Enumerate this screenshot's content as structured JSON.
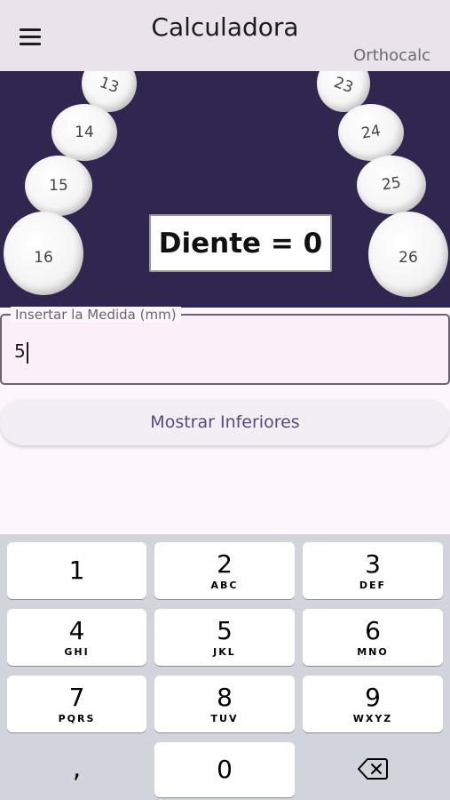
{
  "appbar": {
    "title": "Calculadora",
    "subtitle": "Orthocalc"
  },
  "teeth": [
    {
      "label": "13"
    },
    {
      "label": "14"
    },
    {
      "label": "15"
    },
    {
      "label": "16"
    },
    {
      "label": "23"
    },
    {
      "label": "24"
    },
    {
      "label": "25"
    },
    {
      "label": "26"
    }
  ],
  "display": {
    "text": "Diente = 0"
  },
  "measure_field": {
    "label": "Insertar la Medida (mm)",
    "value": "5"
  },
  "action_button": {
    "label": "Mostrar Inferiores"
  },
  "keypad": {
    "keys": [
      {
        "num": "1",
        "letters": ""
      },
      {
        "num": "2",
        "letters": "ABC"
      },
      {
        "num": "3",
        "letters": "DEF"
      },
      {
        "num": "4",
        "letters": "GHI"
      },
      {
        "num": "5",
        "letters": "JKL"
      },
      {
        "num": "6",
        "letters": "MNO"
      },
      {
        "num": "7",
        "letters": "PQRS"
      },
      {
        "num": "8",
        "letters": "TUV"
      },
      {
        "num": "9",
        "letters": "WXYZ"
      }
    ],
    "comma": ",",
    "zero": "0"
  }
}
